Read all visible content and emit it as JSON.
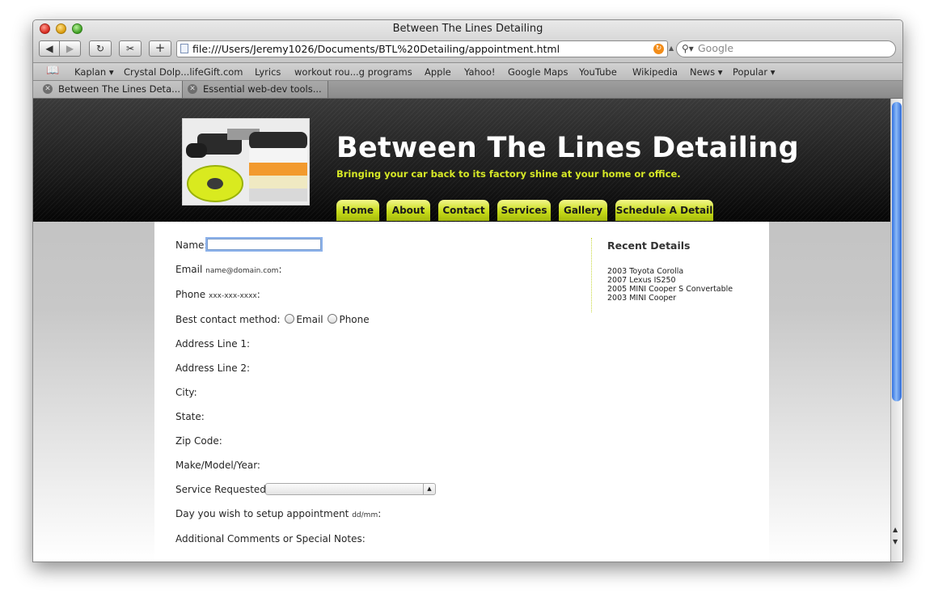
{
  "window": {
    "title": "Between The Lines Detailing"
  },
  "toolbar": {
    "back_label": "◀",
    "forward_label": "▶",
    "reload_label": "↻",
    "snippet_label": "✂",
    "add_tab_label": "+",
    "url": "file:///Users/Jeremy1026/Documents/BTL%20Detailing/appointment.html",
    "rss_label": "↻",
    "search_placeholder": "Google"
  },
  "bookmarks": {
    "items": [
      {
        "label": "Kaplan ▾"
      },
      {
        "label": "Crystal Dolp...lifeGift.com"
      },
      {
        "label": "Lyrics"
      },
      {
        "label": "workout rou...g programs"
      },
      {
        "label": "Apple"
      },
      {
        "label": "Yahoo!"
      },
      {
        "label": "Google Maps"
      },
      {
        "label": "YouTube"
      },
      {
        "label": "Wikipedia"
      },
      {
        "label": "News ▾"
      },
      {
        "label": "Popular ▾"
      }
    ]
  },
  "tabs": [
    {
      "label": "Between The Lines Deta...",
      "active": true
    },
    {
      "label": "Essential web-dev tools...",
      "active": false
    }
  ],
  "site": {
    "title": "Between The Lines Detailing",
    "tagline": "Bringing your car back to its factory shine at your home or office.",
    "nav": [
      {
        "label": "Home"
      },
      {
        "label": "About"
      },
      {
        "label": "Contact"
      },
      {
        "label": "Services"
      },
      {
        "label": "Gallery"
      },
      {
        "label": "Schedule A Detail"
      }
    ],
    "accent_color": "#d6e826"
  },
  "form": {
    "name_label": "Name:",
    "email_label": "Email",
    "email_hint": "name@domain.com",
    "phone_label": "Phone",
    "phone_hint": "xxx-xxx-xxxx",
    "contact_method_label": "Best contact method:",
    "contact_options": [
      "Email",
      "Phone"
    ],
    "address1_label": "Address Line 1:",
    "address2_label": "Address Line 2:",
    "city_label": "City:",
    "state_label": "State:",
    "zip_label": "Zip Code:",
    "vehicle_label": "Make/Model/Year:",
    "service_label": "Service Requested:",
    "service_selected": "",
    "date_label": "Day you wish to setup appointment",
    "date_hint": "dd/mm",
    "comments_label": "Additional Comments or Special Notes:"
  },
  "sidebar": {
    "heading": "Recent Details",
    "items": [
      "2003 Toyota Corolla",
      "2007 Lexus IS250",
      "2005 MINI Cooper S Convertable",
      "2003 MINI Cooper"
    ]
  }
}
